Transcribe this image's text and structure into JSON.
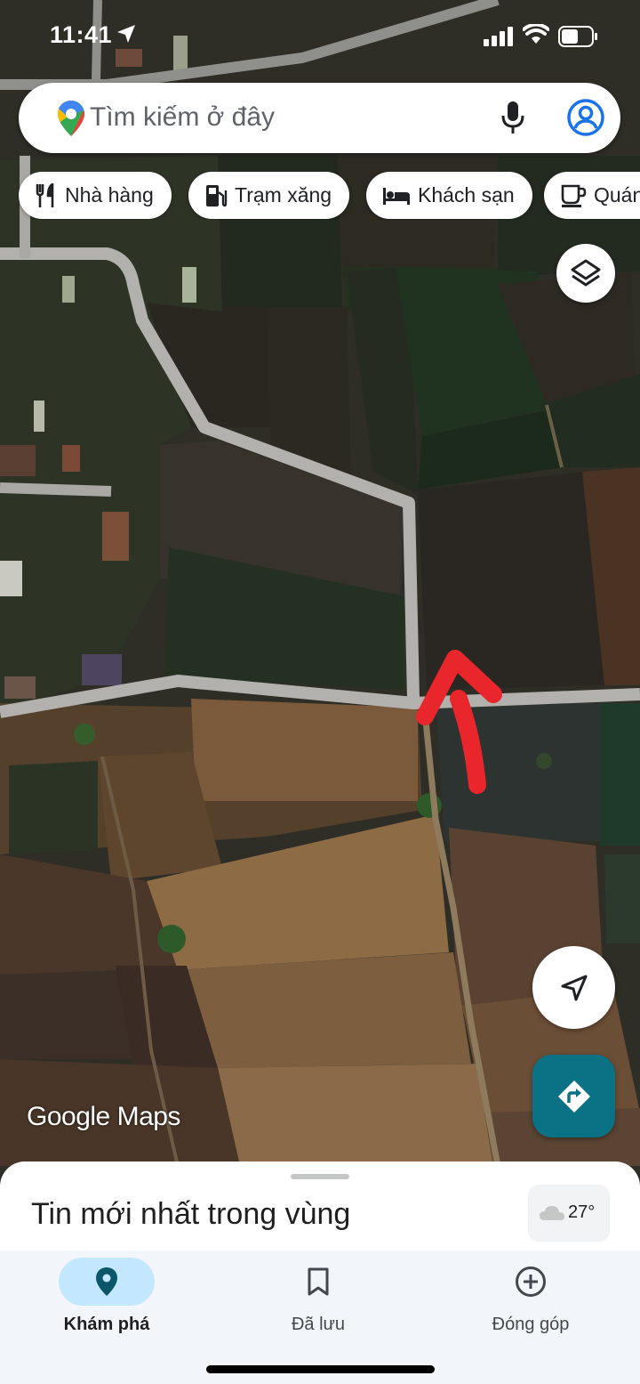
{
  "status_bar": {
    "time": "11:41",
    "location_icon": "location-arrow-icon",
    "signal_icon": "signal-icon",
    "wifi_icon": "wifi-icon",
    "battery_icon": "battery-icon"
  },
  "search": {
    "placeholder": "Tìm kiếm ở đây",
    "logo_icon": "google-maps-pin-icon",
    "mic_icon": "mic-icon",
    "account_icon": "account-icon"
  },
  "chips": [
    {
      "label": "Nhà hàng",
      "icon": "restaurant-icon"
    },
    {
      "label": "Trạm xăng",
      "icon": "gas-station-icon"
    },
    {
      "label": "Khách sạn",
      "icon": "hotel-icon"
    },
    {
      "label": "Quán cà phê",
      "icon": "coffee-icon"
    }
  ],
  "map": {
    "watermark": "Google Maps",
    "annotation": "red-arrow"
  },
  "buttons": {
    "layers_icon": "layers-icon",
    "navigate_icon": "navigation-arrow-icon",
    "directions_icon": "directions-icon"
  },
  "sheet": {
    "title": "Tin mới nhất trong vùng",
    "weather_temp": "27°",
    "weather_icon": "cloud-icon"
  },
  "bottom_nav": [
    {
      "label": "Khám phá",
      "icon": "explore-pin-icon",
      "active": true
    },
    {
      "label": "Đã lưu",
      "icon": "bookmark-icon",
      "active": false
    },
    {
      "label": "Đóng góp",
      "icon": "add-circle-icon",
      "active": false
    }
  ],
  "colors": {
    "accent": "#0b7285",
    "active_tab": "#c2e7ff",
    "annotation": "#e8262b"
  }
}
